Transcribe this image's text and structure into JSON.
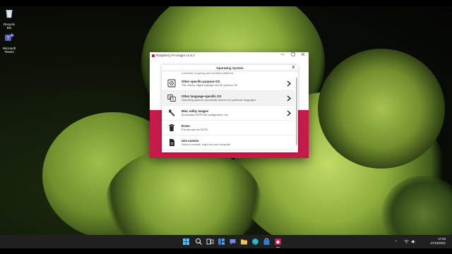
{
  "desktop": {
    "icons": [
      {
        "label": "Recycle Bin",
        "icon": "recycle-bin-icon"
      },
      {
        "label": "Microsoft Teams",
        "icon": "teams-icon"
      }
    ]
  },
  "window": {
    "title": "Raspberry Pi Imager v1.6.2",
    "controls": [
      "minimize",
      "maximize",
      "close"
    ]
  },
  "dialog": {
    "title": "Operating System",
    "close_label": "X",
    "partial_text": "A selection of gaming and emulation platforms",
    "items": [
      {
        "name": "Other specific-purpose OS",
        "description": "Thin clients, digital signage and 3D printers OS",
        "icon": "media-server-icon",
        "has_submenu": true
      },
      {
        "name": "Other language-specific OS",
        "description": "Operating systems specifically tailored for particular languages",
        "icon": "language-icon",
        "has_submenu": true
      },
      {
        "name": "Misc utility images",
        "description": "Bootloader EEPROM configuration, etc.",
        "icon": "wrench-icon",
        "has_submenu": true
      },
      {
        "name": "Erase",
        "description": "Format card as FAT32",
        "icon": "trash-icon",
        "has_submenu": false
      },
      {
        "name": "Use custom",
        "description": "Select a custom .img from your computer",
        "icon": "file-icon",
        "has_submenu": false
      }
    ]
  },
  "taskbar": {
    "apps": [
      "start-icon",
      "search-icon",
      "task-view-icon",
      "widgets-icon",
      "chat-icon",
      "file-explorer-icon",
      "edge-icon",
      "store-icon",
      "raspberry-pi-imager-icon"
    ],
    "time": "17:53",
    "date": "27/10/2021",
    "tray_chevron": "^"
  },
  "colors": {
    "accent": "#c51a4a",
    "taskbar": "#202020"
  }
}
